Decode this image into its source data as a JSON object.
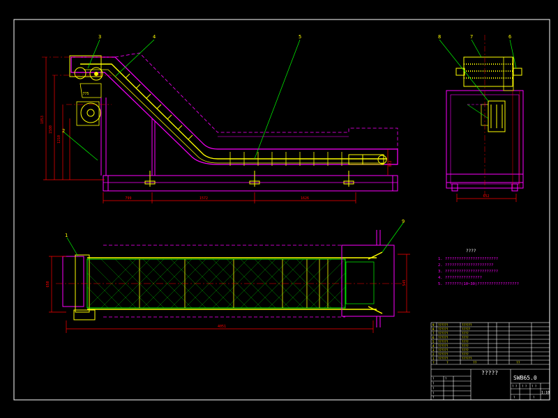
{
  "drawing": {
    "background": "#000000",
    "colors": {
      "frame": "#ffffff",
      "structure": "#ff00ff",
      "part": "#ffff00",
      "leader": "#00ff00",
      "center": "#ff0000",
      "dimension": "#ff0000",
      "hidden": "#00ffff"
    },
    "part_balloons": [
      "3",
      "4",
      "5",
      "8",
      "7",
      "6",
      "1",
      "9",
      "2"
    ],
    "dims": {
      "side_bottom": [
        "799",
        "1572",
        "1626"
      ],
      "side_left": [
        "1853",
        "1580",
        "1210",
        "775"
      ],
      "side_right": "822",
      "end_bottom": "652",
      "plan_bottom": "4051",
      "plan_left": "650",
      "plan_right": "545"
    },
    "notes": {
      "title": "????",
      "lines": [
        "1. ???????????????????????",
        "2. ?????????????????????",
        "3. ???????????????????????",
        "4. ????????????????",
        "5. ???????(10~30)??????????????????"
      ]
    },
    "title_block": {
      "drawing_title": "?????",
      "drawing_number": "SWB65.0",
      "scale": "1:10",
      "header_labels": [
        "?",
        "?",
        "??",
        "??"
      ],
      "part_rows": [
        {
          "no": "9",
          "name": "??????",
          "code": "??????"
        },
        {
          "no": "8",
          "name": "??????",
          "code": "?????"
        },
        {
          "no": "7",
          "name": "??????",
          "code": "????"
        },
        {
          "no": "6",
          "name": "??????",
          "code": "????"
        },
        {
          "no": "5",
          "name": "??????",
          "code": "????"
        },
        {
          "no": "4",
          "name": "??????",
          "code": "????"
        },
        {
          "no": "3",
          "name": "??????",
          "code": "????"
        },
        {
          "no": "2",
          "name": "??????",
          "code": "????"
        },
        {
          "no": "1",
          "name": "??????",
          "code": "??????"
        }
      ],
      "sign_labels": [
        "?",
        "?",
        "?",
        "?",
        "?",
        "?"
      ],
      "meta_labels": [
        "? ?",
        "? ?",
        "? ?"
      ],
      "sheet_labels": [
        "?",
        "?"
      ]
    }
  }
}
